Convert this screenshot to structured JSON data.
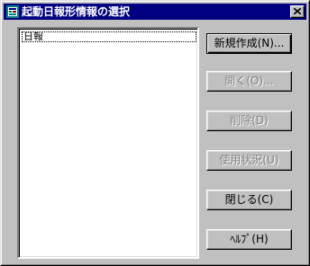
{
  "window": {
    "title": "起動日報形情報の選択"
  },
  "list": {
    "items": [
      "日報"
    ]
  },
  "buttons": {
    "new": "新規作成(N)...",
    "open": "開く(O)...",
    "delete": "削除(D)",
    "usage": "使用状況(U)",
    "close": "閉じる(C)",
    "help": "ﾍﾙﾌﾟ(H)"
  },
  "colors": {
    "titlebar": "#000080",
    "face": "#c0c0c0",
    "disabled_text": "#808080"
  }
}
